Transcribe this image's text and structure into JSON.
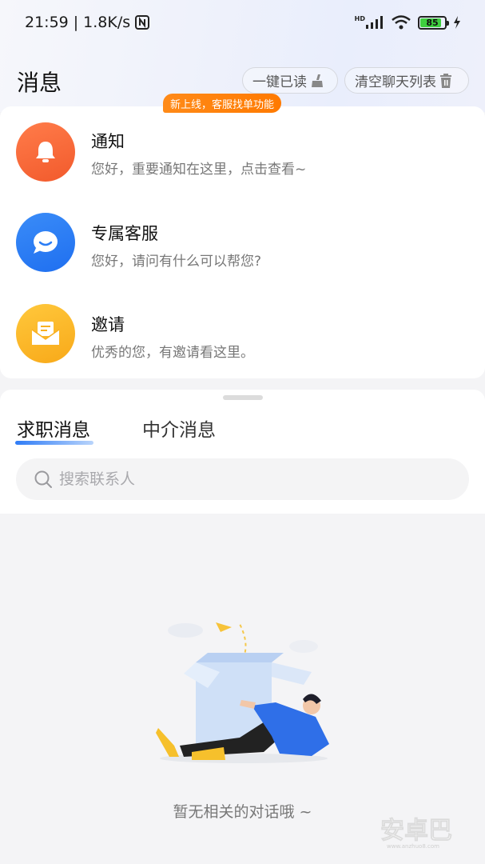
{
  "status_bar": {
    "time": "21:59",
    "speed": "1.8K/s",
    "battery": "85",
    "network_label": "HD"
  },
  "header": {
    "title": "消息",
    "mark_read_label": "一键已读",
    "clear_list_label": "清空聊天列表"
  },
  "messages": [
    {
      "title": "通知",
      "subtitle": "您好，重要通知在这里，点击查看~",
      "icon": "bell-icon",
      "color": "#fa6a3a"
    },
    {
      "title": "专属客服",
      "subtitle": "您好，请问有什么可以帮您?",
      "icon": "chat-bubble-icon",
      "color": "#2b7df5"
    },
    {
      "title": "邀请",
      "subtitle": "优秀的您，有邀请看这里。",
      "icon": "envelope-icon",
      "color": "#fbb826"
    }
  ],
  "badge": "新上线，客服找单功能",
  "tabs": {
    "active": "求职消息",
    "inactive": "中介消息"
  },
  "search": {
    "placeholder": "搜索联系人"
  },
  "empty_state": {
    "text": "暂无相关的对话哦 ~"
  },
  "watermark": "安卓巴",
  "colors": {
    "accent": "#2f7cf6",
    "badge": "#ff7a00"
  }
}
